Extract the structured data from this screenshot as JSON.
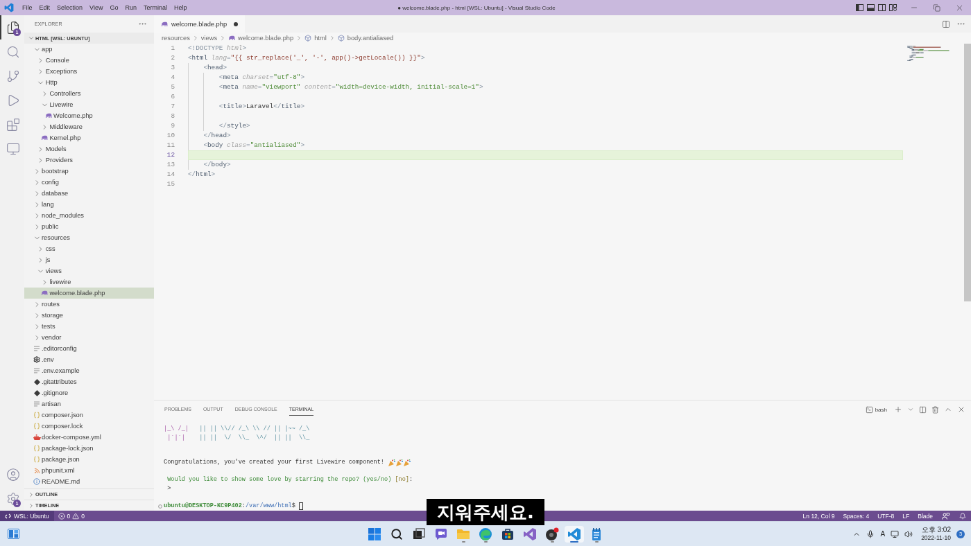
{
  "window": {
    "title": "● welcome.blade.php - html [WSL: Ubuntu] - Visual Studio Code",
    "menu": [
      "File",
      "Edit",
      "Selection",
      "View",
      "Go",
      "Run",
      "Terminal",
      "Help"
    ],
    "layout_toggles": [
      {
        "kind": "sidebar",
        "on": true
      },
      {
        "kind": "panel",
        "on": true
      },
      {
        "kind": "secondary",
        "on": false
      }
    ]
  },
  "activity_bar": {
    "items": [
      {
        "kind": "explorer",
        "selected": true,
        "badge": "1"
      },
      {
        "kind": "search",
        "selected": false
      },
      {
        "kind": "source-control",
        "selected": false
      },
      {
        "kind": "run",
        "selected": false
      },
      {
        "kind": "extensions",
        "selected": false
      },
      {
        "kind": "remote",
        "selected": false
      }
    ],
    "bottom": [
      {
        "kind": "account"
      },
      {
        "kind": "settings",
        "badge": "1"
      }
    ]
  },
  "sidebar": {
    "title": "EXPLORER",
    "root": {
      "label": "HTML [WSL: UBUNTU]",
      "expanded": true
    },
    "tree": [
      {
        "label": "app",
        "kind": "folder",
        "expanded": true,
        "selected": false,
        "children": [
          {
            "label": "Console",
            "kind": "folder",
            "expanded": false,
            "selected": false
          },
          {
            "label": "Exceptions",
            "kind": "folder",
            "expanded": false,
            "selected": false
          },
          {
            "label": "Http",
            "kind": "folder",
            "expanded": true,
            "selected": false,
            "children": [
              {
                "label": "Controllers",
                "kind": "folder",
                "expanded": false,
                "selected": false
              },
              {
                "label": "Livewire",
                "kind": "folder",
                "expanded": true,
                "selected": false,
                "children": [
                  {
                    "label": "Welcome.php",
                    "kind": "php",
                    "selected": false
                  }
                ]
              },
              {
                "label": "Middleware",
                "kind": "folder",
                "expanded": false,
                "selected": false
              },
              {
                "label": "Kernel.php",
                "kind": "php",
                "selected": false
              }
            ]
          },
          {
            "label": "Models",
            "kind": "folder",
            "expanded": false,
            "selected": false
          },
          {
            "label": "Providers",
            "kind": "folder",
            "expanded": false,
            "selected": false
          }
        ]
      },
      {
        "label": "bootstrap",
        "kind": "folder",
        "expanded": false,
        "selected": false
      },
      {
        "label": "config",
        "kind": "folder",
        "expanded": false,
        "selected": false
      },
      {
        "label": "database",
        "kind": "folder",
        "expanded": false,
        "selected": false
      },
      {
        "label": "lang",
        "kind": "folder",
        "expanded": false,
        "selected": false
      },
      {
        "label": "node_modules",
        "kind": "folder",
        "expanded": false,
        "selected": false
      },
      {
        "label": "public",
        "kind": "folder",
        "expanded": false,
        "selected": false
      },
      {
        "label": "resources",
        "kind": "folder",
        "expanded": true,
        "selected": false,
        "children": [
          {
            "label": "css",
            "kind": "folder",
            "expanded": false,
            "selected": false
          },
          {
            "label": "js",
            "kind": "folder",
            "expanded": false,
            "selected": false
          },
          {
            "label": "views",
            "kind": "folder",
            "expanded": true,
            "selected": false,
            "children": [
              {
                "label": "livewire",
                "kind": "folder",
                "expanded": false,
                "selected": false
              },
              {
                "label": "welcome.blade.php",
                "kind": "php",
                "selected": true
              }
            ]
          }
        ]
      },
      {
        "label": "routes",
        "kind": "folder",
        "expanded": false,
        "selected": false
      },
      {
        "label": "storage",
        "kind": "folder",
        "expanded": false,
        "selected": false
      },
      {
        "label": "tests",
        "kind": "folder",
        "expanded": false,
        "selected": false
      },
      {
        "label": "vendor",
        "kind": "folder",
        "expanded": false,
        "selected": false
      },
      {
        "label": ".editorconfig",
        "kind": "text",
        "selected": false
      },
      {
        "label": ".env",
        "kind": "settings",
        "selected": false
      },
      {
        "label": ".env.example",
        "kind": "text",
        "selected": false
      },
      {
        "label": ".gitattributes",
        "kind": "git",
        "selected": false
      },
      {
        "label": ".gitignore",
        "kind": "git",
        "selected": false
      },
      {
        "label": "artisan",
        "kind": "text",
        "selected": false
      },
      {
        "label": "composer.json",
        "kind": "json",
        "selected": false
      },
      {
        "label": "composer.lock",
        "kind": "json",
        "selected": false
      },
      {
        "label": "docker-compose.yml",
        "kind": "docker",
        "selected": false
      },
      {
        "label": "package-lock.json",
        "kind": "json",
        "selected": false
      },
      {
        "label": "package.json",
        "kind": "json",
        "selected": false
      },
      {
        "label": "phpunit.xml",
        "kind": "xml",
        "selected": false
      },
      {
        "label": "README.md",
        "kind": "info",
        "selected": false
      }
    ],
    "sections": [
      {
        "label": "OUTLINE",
        "expanded": false
      },
      {
        "label": "TIMELINE",
        "expanded": false
      }
    ]
  },
  "editor": {
    "tabs": [
      {
        "label": "welcome.blade.php",
        "kind": "php",
        "selected": true,
        "modified": true
      }
    ],
    "breadcrumbs": [
      {
        "kind": "folder",
        "label": "resources"
      },
      {
        "kind": "folder",
        "label": "views"
      },
      {
        "kind": "php",
        "label": "welcome.blade.php"
      },
      {
        "kind": "element",
        "label": "html"
      },
      {
        "kind": "element",
        "label": "body.antialiased"
      }
    ],
    "lines": [
      {
        "number": "1",
        "current": false,
        "tokens": [
          {
            "kind": "punct",
            "text": "<!DOCTYPE"
          },
          {
            "kind": "attr",
            "text": " html"
          },
          {
            "kind": "punct",
            "text": ">"
          }
        ]
      },
      {
        "number": "2",
        "current": false,
        "tokens": [
          {
            "kind": "punct",
            "text": "<"
          },
          {
            "kind": "tag",
            "text": "html"
          },
          {
            "kind": "attr",
            "text": " lang"
          },
          {
            "kind": "punct",
            "text": "="
          },
          {
            "kind": "blade",
            "text": "\"{{ str_replace('_', '-', app()->getLocale()) }}\""
          },
          {
            "kind": "punct",
            "text": ">"
          }
        ]
      },
      {
        "number": "3",
        "current": false,
        "tokens": [
          {
            "kind": "punct",
            "text": "    <"
          },
          {
            "kind": "tag",
            "text": "head"
          },
          {
            "kind": "punct",
            "text": ">"
          }
        ]
      },
      {
        "number": "4",
        "current": false,
        "tokens": [
          {
            "kind": "punct",
            "text": "        <"
          },
          {
            "kind": "tag",
            "text": "meta"
          },
          {
            "kind": "attr",
            "text": " charset"
          },
          {
            "kind": "punct",
            "text": "="
          },
          {
            "kind": "string",
            "text": "\"utf-8\""
          },
          {
            "kind": "punct",
            "text": ">"
          }
        ]
      },
      {
        "number": "5",
        "current": false,
        "tokens": [
          {
            "kind": "punct",
            "text": "        <"
          },
          {
            "kind": "tag",
            "text": "meta"
          },
          {
            "kind": "attr",
            "text": " name"
          },
          {
            "kind": "punct",
            "text": "="
          },
          {
            "kind": "string",
            "text": "\"viewport\""
          },
          {
            "kind": "attr",
            "text": " content"
          },
          {
            "kind": "punct",
            "text": "="
          },
          {
            "kind": "string",
            "text": "\"width=device-width, initial-scale=1\""
          },
          {
            "kind": "punct",
            "text": ">"
          }
        ]
      },
      {
        "number": "6",
        "current": false
      },
      {
        "number": "7",
        "current": false,
        "tokens": [
          {
            "kind": "punct",
            "text": "        <"
          },
          {
            "kind": "tag",
            "text": "title"
          },
          {
            "kind": "punct",
            "text": ">"
          },
          {
            "kind": "text",
            "text": "Laravel"
          },
          {
            "kind": "punct",
            "text": "</"
          },
          {
            "kind": "tag",
            "text": "title"
          },
          {
            "kind": "punct",
            "text": ">"
          }
        ]
      },
      {
        "number": "8",
        "current": false
      },
      {
        "number": "9",
        "current": false,
        "tokens": [
          {
            "kind": "punct",
            "text": "        </"
          },
          {
            "kind": "tag",
            "text": "style"
          },
          {
            "kind": "punct",
            "text": ">"
          }
        ]
      },
      {
        "number": "10",
        "current": false,
        "tokens": [
          {
            "kind": "punct",
            "text": "    </"
          },
          {
            "kind": "tag",
            "text": "head"
          },
          {
            "kind": "punct",
            "text": ">"
          }
        ]
      },
      {
        "number": "11",
        "current": false,
        "tokens": [
          {
            "kind": "punct",
            "text": "    <"
          },
          {
            "kind": "tag",
            "text": "body"
          },
          {
            "kind": "attr",
            "text": " class"
          },
          {
            "kind": "punct",
            "text": "="
          },
          {
            "kind": "string",
            "text": "\"antialiased\""
          },
          {
            "kind": "punct",
            "text": ">"
          }
        ]
      },
      {
        "number": "12",
        "current": true
      },
      {
        "number": "13",
        "current": false,
        "tokens": [
          {
            "kind": "punct",
            "text": "    </"
          },
          {
            "kind": "tag",
            "text": "body"
          },
          {
            "kind": "punct",
            "text": ">"
          }
        ]
      },
      {
        "number": "14",
        "current": false,
        "tokens": [
          {
            "kind": "punct",
            "text": "</"
          },
          {
            "kind": "tag",
            "text": "html"
          },
          {
            "kind": "punct",
            "text": ">"
          }
        ]
      },
      {
        "number": "15",
        "current": false
      }
    ]
  },
  "panel": {
    "tabs": [
      {
        "label": "PROBLEMS",
        "selected": false
      },
      {
        "label": "OUTPUT",
        "selected": false
      },
      {
        "label": "DEBUG CONSOLE",
        "selected": false
      },
      {
        "label": "TERMINAL",
        "selected": true
      }
    ],
    "shell": "bash",
    "terminal": {
      "blocks": [
        {
          "lines": [
            {
              "segments": [
                {
                  "kind": "logo",
                  "text": "|_\\ /_|"
                },
                {
                  "kind": "art",
                  "text": "   || || \\\\// /_\\ \\\\ // || |~~ /_\\"
                }
              ]
            },
            {
              "segments": [
                {
                  "kind": "logo",
                  "text": " |`|`|"
                },
                {
                  "kind": "art",
                  "text": "    || ||  \\/  \\\\_  \\^/  || ||  \\\\_"
                }
              ]
            }
          ]
        },
        {
          "lines": [
            {
              "segments": [
                {
                  "kind": "text",
                  "text": "Congratulations, you've created your first Livewire component!"
                },
                {
                  "kind": "emoji"
                },
                {
                  "kind": "emoji"
                },
                {
                  "kind": "emoji"
                }
              ]
            }
          ]
        },
        {
          "lines": [
            {
              "segments": [
                {
                  "kind": "question",
                  "text": " Would you like to show some love by starring the repo? (yes/no)"
                },
                {
                  "kind": "default",
                  "text": " [no]"
                },
                {
                  "kind": "text",
                  "text": ":"
                }
              ]
            },
            {
              "segments": [
                {
                  "kind": "text",
                  "text": " >"
                }
              ]
            }
          ]
        },
        {
          "lines": [
            {
              "segments": [
                {
                  "kind": "decoration"
                },
                {
                  "kind": "user",
                  "text": "ubuntu@DESKTOP-KC9P402"
                },
                {
                  "kind": "text",
                  "text": ":"
                },
                {
                  "kind": "path",
                  "text": "/var/www/html"
                },
                {
                  "kind": "text",
                  "text": "$"
                },
                {
                  "kind": "cursor"
                }
              ]
            }
          ]
        }
      ]
    }
  },
  "status_bar": {
    "remote": "WSL: Ubuntu",
    "errors": "0",
    "warnings": "0",
    "items": [
      "Ln 12, Col 9",
      "Spaces: 4",
      "UTF-8",
      "LF",
      "Blade"
    ]
  },
  "taskbar": {
    "apps": [
      {
        "kind": "start",
        "selected": false,
        "running": false
      },
      {
        "kind": "search",
        "selected": false,
        "running": false
      },
      {
        "kind": "taskview",
        "selected": false,
        "running": false
      },
      {
        "kind": "chat",
        "selected": false,
        "running": false
      },
      {
        "kind": "files",
        "selected": false,
        "running": true
      },
      {
        "kind": "browser",
        "selected": false,
        "running": true
      },
      {
        "kind": "store",
        "selected": false,
        "running": false
      },
      {
        "kind": "studio",
        "selected": false,
        "running": false
      },
      {
        "kind": "recorder",
        "selected": false,
        "running": true
      },
      {
        "kind": "code",
        "selected": true,
        "running": true
      },
      {
        "kind": "notepad",
        "selected": false,
        "running": true
      }
    ],
    "tray": {
      "ime": "A",
      "time": "오후 3:02",
      "date": "2022-11-10",
      "notifications": "3"
    }
  },
  "caption": "지워주세요."
}
